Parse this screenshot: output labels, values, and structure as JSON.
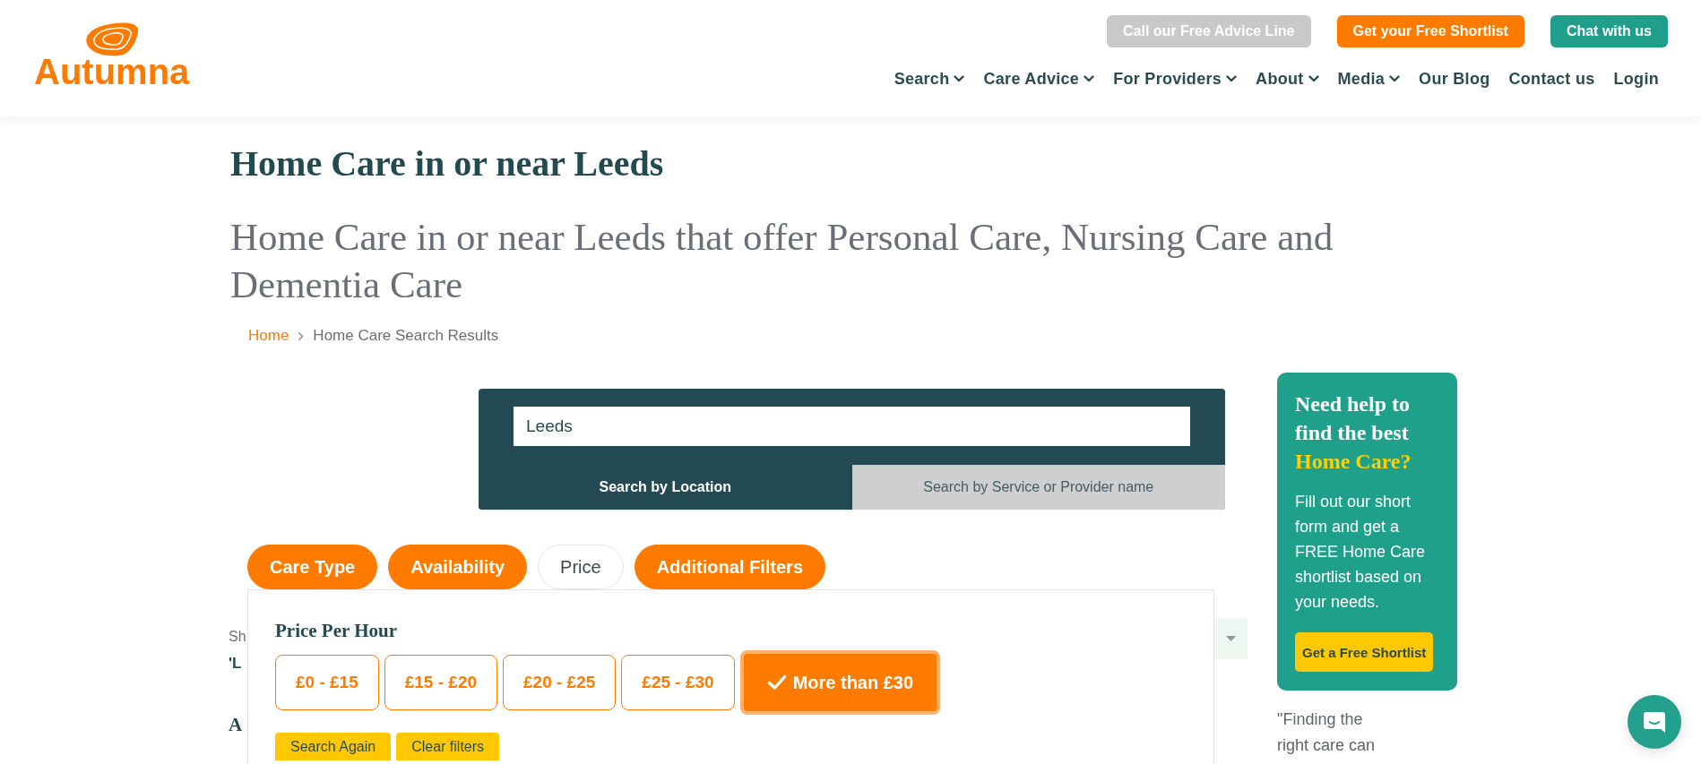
{
  "header": {
    "logo": "Autumna",
    "action_buttons": [
      {
        "label": "Call our Free Advice Line",
        "kind": "muted"
      },
      {
        "label": "Get your Free Shortlist",
        "kind": "primary"
      },
      {
        "label": "Chat with us",
        "kind": "chat"
      }
    ],
    "nav": [
      {
        "label": "Search",
        "has_menu": true
      },
      {
        "label": "Care Advice",
        "has_menu": true
      },
      {
        "label": "For Providers",
        "has_menu": true
      },
      {
        "label": "About",
        "has_menu": true
      },
      {
        "label": "Media",
        "has_menu": true
      },
      {
        "label": "Our Blog",
        "has_menu": false
      },
      {
        "label": "Contact us",
        "has_menu": false
      },
      {
        "label": "Login",
        "has_menu": false
      }
    ]
  },
  "page": {
    "title": "Home Care in or near Leeds",
    "subtitle": "Home Care in or near Leeds that offer Personal Care, Nursing Care and Dementia Care",
    "breadcrumb": [
      {
        "label": "Home",
        "kind": "link"
      },
      {
        "label": "Home Care Search Results",
        "kind": "current"
      }
    ]
  },
  "search": {
    "value": "Leeds",
    "tabs": [
      {
        "label": "Search by Location",
        "selected": true
      },
      {
        "label": "Search by Service or Provider name",
        "selected": false
      }
    ]
  },
  "filters": {
    "tabs": [
      {
        "label": "Care Type",
        "selected": false
      },
      {
        "label": "Availability",
        "selected": false
      },
      {
        "label": "Price",
        "selected": true
      },
      {
        "label": "Additional Filters",
        "selected": false
      }
    ],
    "panel": {
      "heading": "Price Per Hour",
      "options": [
        {
          "label": "£0 - £15",
          "selected": false
        },
        {
          "label": "£15 - £20",
          "selected": false
        },
        {
          "label": "£20 - £25",
          "selected": false
        },
        {
          "label": "£25 - £30",
          "selected": false
        },
        {
          "label": "More than £30",
          "selected": true
        }
      ],
      "buttons": [
        "Search Again",
        "Clear filters"
      ]
    }
  },
  "results": {
    "lines": [
      {
        "text": "Sh",
        "kind": "summary"
      },
      {
        "text": "'L",
        "kind": "query"
      },
      {
        "text": "A",
        "kind": "heading"
      }
    ]
  },
  "sidebar": {
    "heading": "Need help to find the best",
    "highlight": "Home Care?",
    "body": "Fill out our short form and get a FREE Home Care shortlist based on your needs.",
    "button": "Get a Free Shortlist",
    "quote": "\"Finding the right care can"
  }
}
